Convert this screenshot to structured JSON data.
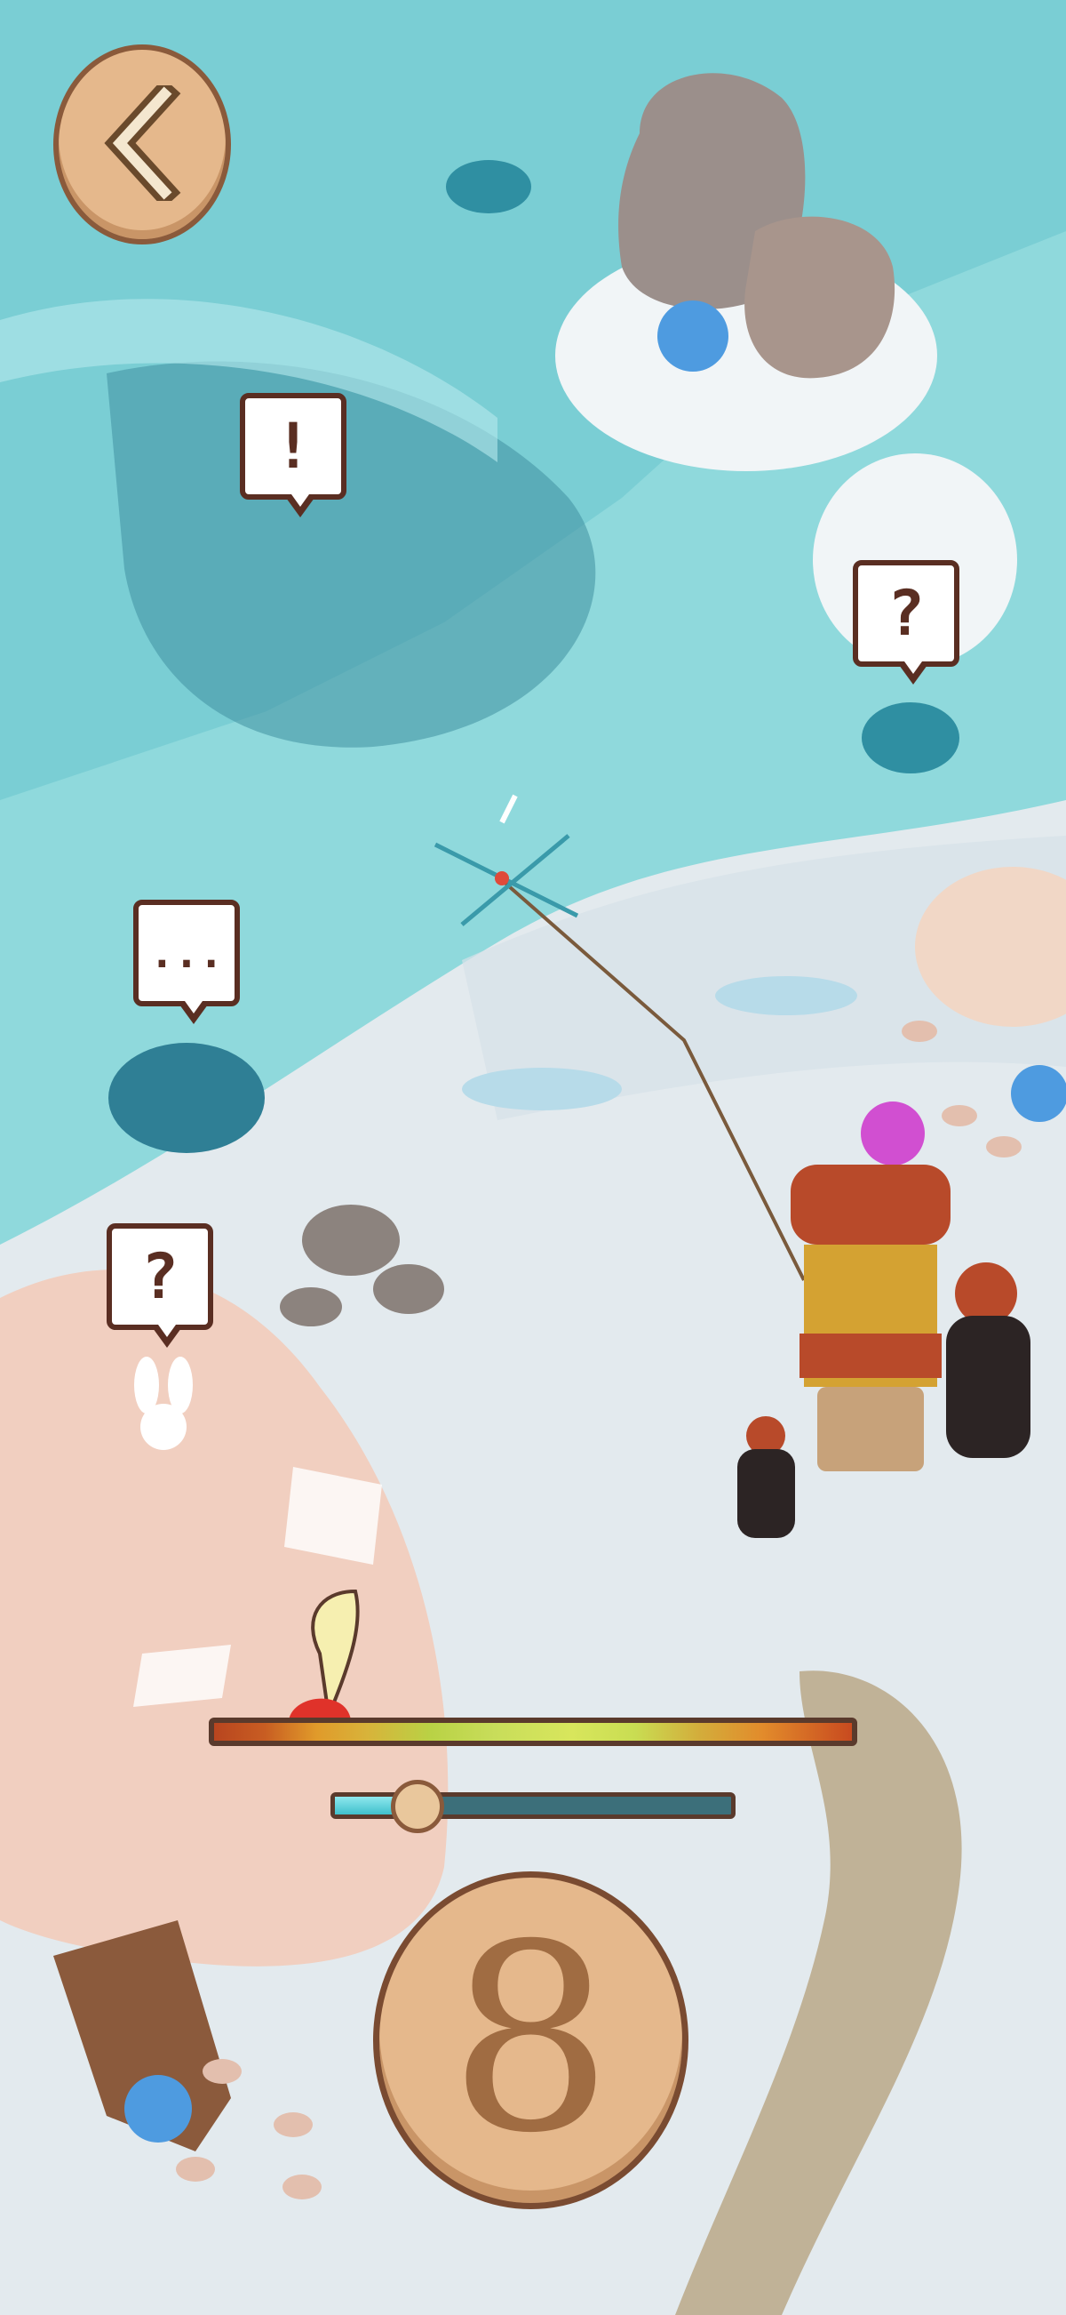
{
  "hud": {
    "back_icon": "chevron-left-icon",
    "cast_count": "8"
  },
  "bubbles": [
    {
      "name": "alert-bubble",
      "symbol": "!"
    },
    {
      "name": "question-bubble-top-right",
      "symbol": "?"
    },
    {
      "name": "ellipsis-bubble",
      "symbol": "..."
    },
    {
      "name": "question-bubble-bottom-left",
      "symbol": "?"
    }
  ],
  "meters": {
    "power": 0.25,
    "reel": 0.2
  },
  "colors": {
    "water": "#7fd4d8",
    "deep_water": "#3f9aa8",
    "snow": "#e5ecf0",
    "outline": "#5a2e22",
    "button": "#e5b88c"
  }
}
